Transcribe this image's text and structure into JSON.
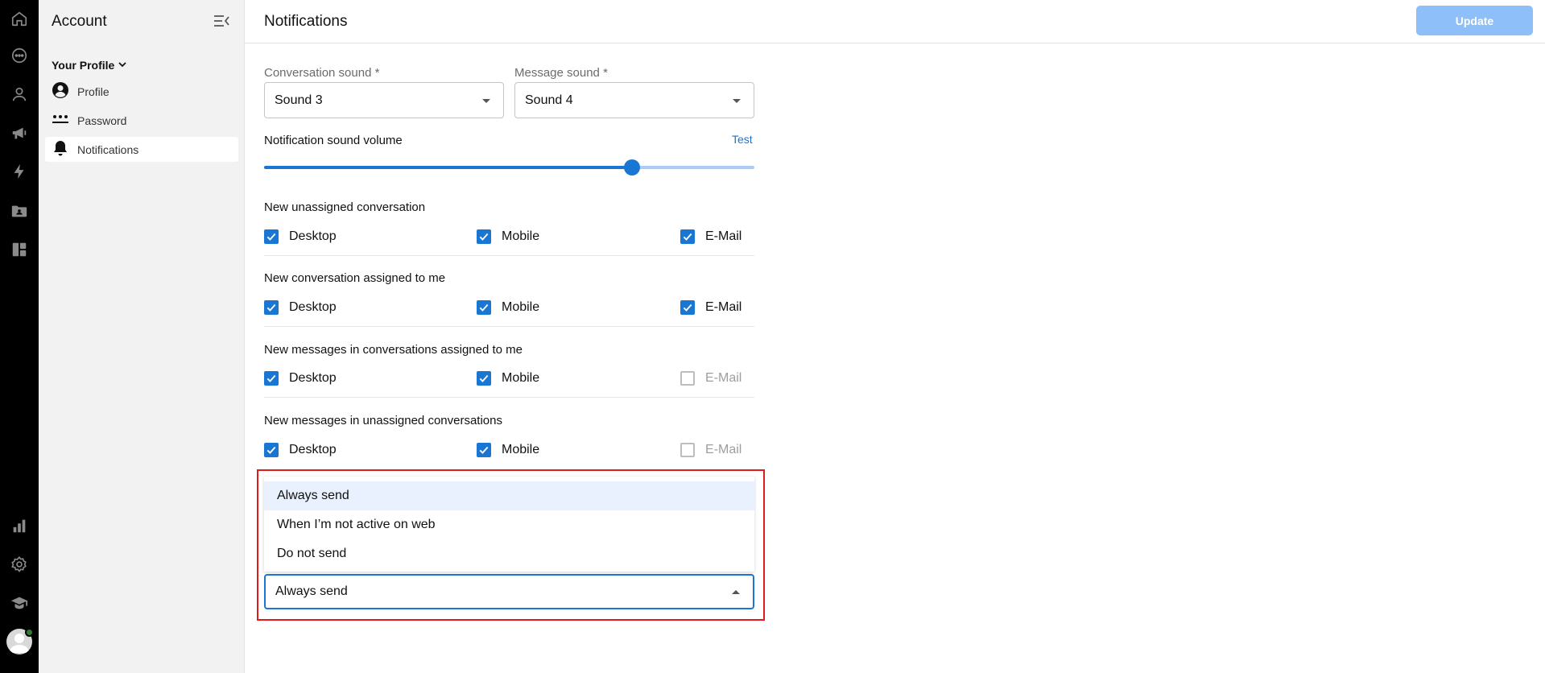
{
  "sidebar": {
    "title": "Account",
    "section_label": "Your Profile",
    "items": [
      {
        "label": "Profile"
      },
      {
        "label": "Password"
      },
      {
        "label": "Notifications"
      }
    ]
  },
  "header": {
    "title": "Notifications",
    "update_label": "Update"
  },
  "sounds": {
    "conversation_label": "Conversation sound *",
    "conversation_value": "Sound 3",
    "message_label": "Message sound *",
    "message_value": "Sound 4"
  },
  "volume": {
    "label": "Notification sound volume",
    "test_label": "Test",
    "level_percent": 75
  },
  "groups": [
    {
      "title": "New unassigned conversation",
      "options": [
        {
          "label": "Desktop",
          "checked": true
        },
        {
          "label": "Mobile",
          "checked": true
        },
        {
          "label": "E-Mail",
          "checked": true
        }
      ]
    },
    {
      "title": "New conversation assigned to me",
      "options": [
        {
          "label": "Desktop",
          "checked": true
        },
        {
          "label": "Mobile",
          "checked": true
        },
        {
          "label": "E-Mail",
          "checked": true
        }
      ]
    },
    {
      "title": "New messages in conversations assigned to me",
      "options": [
        {
          "label": "Desktop",
          "checked": true
        },
        {
          "label": "Mobile",
          "checked": true
        },
        {
          "label": "E-Mail",
          "checked": false
        }
      ]
    },
    {
      "title": "New messages in unassigned conversations",
      "options": [
        {
          "label": "Desktop",
          "checked": true
        },
        {
          "label": "Mobile",
          "checked": true
        },
        {
          "label": "E-Mail",
          "checked": false
        }
      ]
    }
  ],
  "email_mode": {
    "options": [
      "Always send",
      "When I’m not active on web",
      "Do not send"
    ],
    "selected": "Always send"
  },
  "colors": {
    "accent": "#1976d2",
    "highlight_border": "#e01b1b",
    "update_button": "#8fbff8"
  },
  "icons": {
    "rail": [
      "home-icon",
      "chat-icon",
      "contacts-icon",
      "megaphone-icon",
      "bolt-icon",
      "folder-icon",
      "dashboard-icon",
      "reports-icon",
      "settings-icon",
      "academy-icon"
    ]
  }
}
